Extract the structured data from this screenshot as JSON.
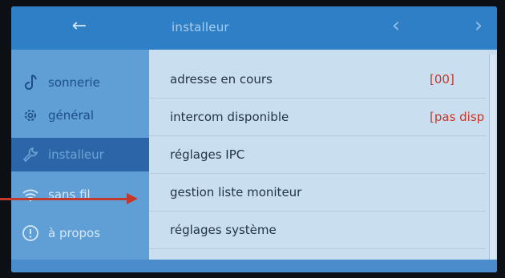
{
  "header": {
    "back_icon": "back-arrow-icon",
    "title": "installeur",
    "prev_icon": "chevron-left-icon",
    "next_icon": "chevron-right-icon"
  },
  "sidebar": {
    "items": [
      {
        "label": "sonnerie",
        "icon": "music-note-icon",
        "active": false
      },
      {
        "label": "général",
        "icon": "gear-icon",
        "active": false
      },
      {
        "label": "installeur",
        "icon": "wrench-icon",
        "active": true
      },
      {
        "label": "sans fil",
        "icon": "wifi-icon",
        "active": false
      },
      {
        "label": "à propos",
        "icon": "info-icon",
        "active": false
      }
    ]
  },
  "main": {
    "rows": [
      {
        "label": "adresse en cours",
        "value": "[00]"
      },
      {
        "label": "intercom disponible",
        "value": "[pas disp"
      },
      {
        "label": "réglages IPC",
        "value": ""
      },
      {
        "label": "gestion liste moniteur",
        "value": ""
      },
      {
        "label": "réglages système",
        "value": ""
      }
    ]
  },
  "colors": {
    "topbar": "#2f7fc6",
    "sidebar": "#5f9fd5",
    "sidebar_active": "#2c66a8",
    "list_bg": "#c9deef",
    "value_red": "#c0392b",
    "annotation_arrow": "#c0392b"
  }
}
